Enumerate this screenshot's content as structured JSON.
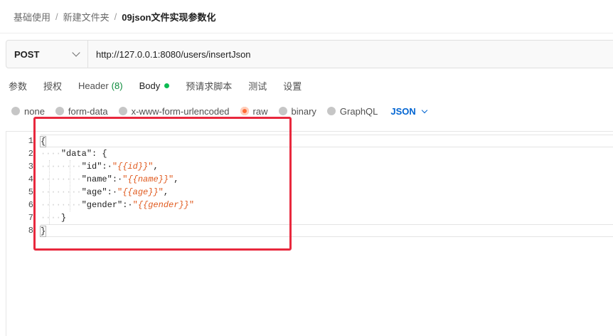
{
  "breadcrumb": [
    "基础使用",
    "/",
    "新建文件夹",
    "/",
    "09json文件实现参数化"
  ],
  "request": {
    "method": "POST",
    "url": "http://127.0.0.1:8080/users/insertJson"
  },
  "tabs": [
    {
      "label": "参数"
    },
    {
      "label": "授权"
    },
    {
      "label": "Header",
      "count": "(8)"
    },
    {
      "label": "Body"
    },
    {
      "label": "预请求脚本"
    },
    {
      "label": "测试"
    },
    {
      "label": "设置"
    }
  ],
  "body_types": {
    "options": [
      "none",
      "form-data",
      "x-www-form-urlencoded",
      "raw",
      "binary",
      "GraphQL"
    ],
    "selected": "raw",
    "format": "JSON"
  },
  "editor": {
    "line_numbers": [
      "1",
      "2",
      "3",
      "4",
      "5",
      "6",
      "7",
      "8"
    ],
    "lines": [
      "{",
      "    \"data\": {",
      "        \"id\": \"{{id}}\",",
      "        \"name\": \"{{name}}\",",
      "        \"age\": \"{{age}}\",",
      "        \"gender\": \"{{gender}}\"",
      "    }",
      "}"
    ]
  },
  "colors": {
    "accent": "#ff6c37",
    "link": "#0265d2",
    "annotation": "#e8283d",
    "status_dot": "#0cbb52"
  }
}
